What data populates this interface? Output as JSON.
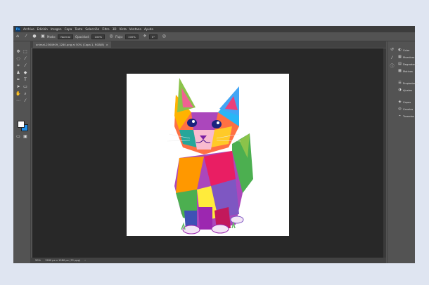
{
  "app": {
    "logo": "Ps"
  },
  "menubar": [
    "Archivo",
    "Edición",
    "Imagen",
    "Capa",
    "Texto",
    "Selección",
    "Filtro",
    "3D",
    "Vista",
    "Ventana",
    "Ayuda"
  ],
  "options": {
    "mode_label": "Modo:",
    "mode_value": "Normal",
    "opacity_label": "Opacidad:",
    "opacity_value": "100%",
    "flow_label": "Flujo:",
    "flow_value": "100%",
    "angle_value": "0°"
  },
  "document": {
    "tab_title": "animal-2364909_1280.png al 50% (Capa 1, RGB/8)"
  },
  "status": {
    "zoom": "50%",
    "dimensions": "1280 px x 1280 px (72 ppp)"
  },
  "panels": [
    "Color",
    "Muestras",
    "Degradados",
    "Motivos",
    "Propiedades",
    "Ajustes",
    "Capas",
    "Canales",
    "Trazados"
  ],
  "colors": {
    "foreground": "#ffffff",
    "background": "#1e8de8"
  }
}
